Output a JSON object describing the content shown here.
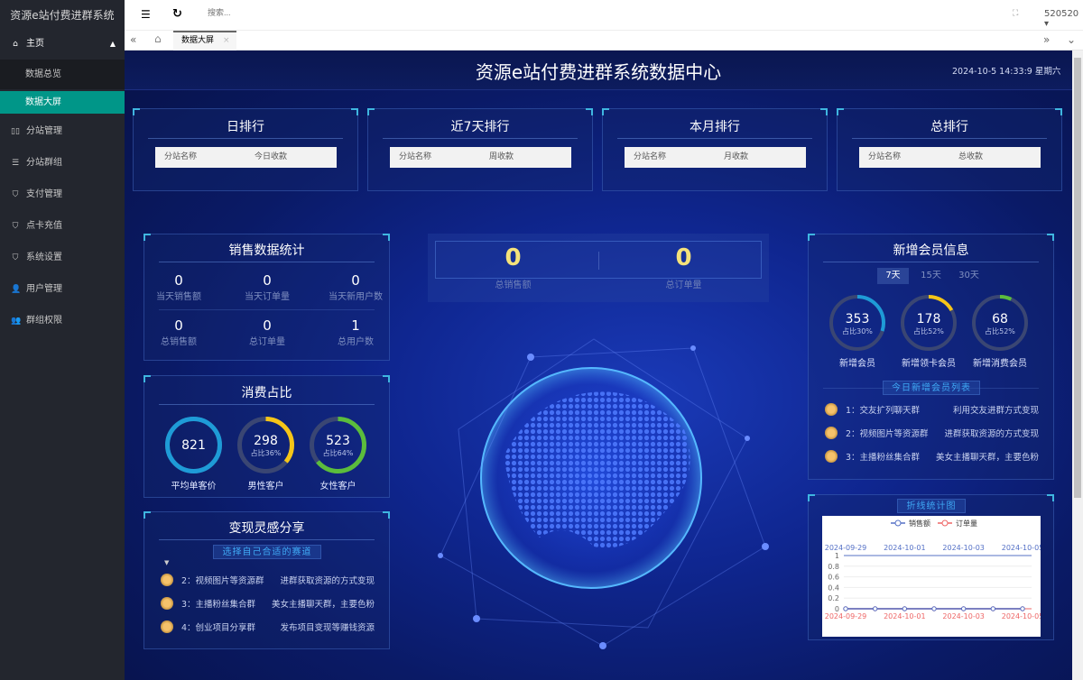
{
  "app": {
    "title": "资源e站付费进群系统",
    "user": "520520"
  },
  "sidebar": {
    "items": [
      {
        "label": "主页",
        "icon": "home-icon"
      },
      {
        "label": "数据总览"
      },
      {
        "label": "数据大屏"
      },
      {
        "label": "分站管理",
        "icon": "columns-icon"
      },
      {
        "label": "分站群组",
        "icon": "sliders-icon"
      },
      {
        "label": "支付管理",
        "icon": "shield-check-icon"
      },
      {
        "label": "点卡充值",
        "icon": "shield-check-icon"
      },
      {
        "label": "系统设置",
        "icon": "shield-check-icon"
      },
      {
        "label": "用户管理",
        "icon": "user-icon"
      },
      {
        "label": "群组权限",
        "icon": "users-icon"
      }
    ]
  },
  "topbar": {
    "search_placeholder": "搜索..."
  },
  "tabs": [
    {
      "label": "数据大屏",
      "active": true
    }
  ],
  "screen": {
    "title": "资源e站付费进群系统数据中心",
    "datetime": "2024-10-5 14:33:9 星期六"
  },
  "rankings": [
    {
      "title": "日排行",
      "col1": "分站名称",
      "col2": "今日收款"
    },
    {
      "title": "近7天排行",
      "col1": "分站名称",
      "col2": "周收款"
    },
    {
      "title": "本月排行",
      "col1": "分站名称",
      "col2": "月收款"
    },
    {
      "title": "总排行",
      "col1": "分站名称",
      "col2": "总收款"
    }
  ],
  "sales": {
    "title": "销售数据统计",
    "stats": [
      {
        "value": "0",
        "label": "当天销售额"
      },
      {
        "value": "0",
        "label": "当天订单量"
      },
      {
        "value": "0",
        "label": "当天新用户数"
      },
      {
        "value": "0",
        "label": "总销售额"
      },
      {
        "value": "0",
        "label": "总订单量"
      },
      {
        "value": "1",
        "label": "总用户数"
      }
    ]
  },
  "consumption": {
    "title": "消费占比",
    "rings": [
      {
        "value": "821",
        "pct_label": "",
        "label": "平均单客价",
        "fraction": 1.0,
        "color": "#1e9bd7"
      },
      {
        "value": "298",
        "pct_label": "占比36%",
        "label": "男性客户",
        "fraction": 0.36,
        "color": "#f5c518"
      },
      {
        "value": "523",
        "pct_label": "占比64%",
        "label": "女性客户",
        "fraction": 0.64,
        "color": "#5bbd3c"
      }
    ]
  },
  "ideas": {
    "title": "变现灵感分享",
    "subtitle": "选择自己合适的赛道",
    "items": [
      {
        "name": "2：视频图片等资源群",
        "desc": "进群获取资源的方式变现"
      },
      {
        "name": "3：主播粉丝集合群",
        "desc": "美女主播聊天群，主要色粉"
      },
      {
        "name": "4：创业项目分享群",
        "desc": "发布项目变现等赚钱资源"
      }
    ]
  },
  "totals": [
    {
      "value": "0",
      "label": "总销售额"
    },
    {
      "value": "0",
      "label": "总订单量"
    }
  ],
  "members": {
    "title": "新增会员信息",
    "periods": [
      "7天",
      "15天",
      "30天"
    ],
    "active_period": "7天",
    "rings": [
      {
        "value": "353",
        "pct_label": "占比30%",
        "label": "新增会员",
        "fraction": 0.3,
        "color": "#1e9bd7"
      },
      {
        "value": "178",
        "pct_label": "占比52%",
        "label": "新增领卡会员",
        "fraction": 0.17,
        "color": "#f5c518"
      },
      {
        "value": "68",
        "pct_label": "占比52%",
        "label": "新增消费会员",
        "fraction": 0.07,
        "color": "#5bbd3c"
      }
    ],
    "list_title": "今日新增会员列表",
    "list": [
      {
        "name": "1：交友扩列聊天群",
        "desc": "利用交友进群方式变现"
      },
      {
        "name": "2：视频图片等资源群",
        "desc": "进群获取资源的方式变现"
      },
      {
        "name": "3：主播粉丝集合群",
        "desc": "美女主播聊天群，主要色粉"
      }
    ]
  },
  "chart_panel_title": "折线统计图",
  "chart_data": {
    "type": "line",
    "x": [
      "2024-09-29",
      "2024-09-30",
      "2024-10-01",
      "2024-10-02",
      "2024-10-03",
      "2024-10-04",
      "2024-10-05"
    ],
    "x_tick_labels": [
      "2024-09-29",
      "2024-10-01",
      "2024-10-03",
      "2024-10-05"
    ],
    "series": [
      {
        "name": "销售额",
        "values": [
          0,
          0,
          0,
          0,
          0,
          0,
          0
        ],
        "color": "#5470c6",
        "axis": "top"
      },
      {
        "name": "订单量",
        "values": [
          0,
          0,
          0,
          0,
          0,
          0,
          0
        ],
        "color": "#ee6666",
        "axis": "bottom"
      }
    ],
    "ylim": [
      0,
      1
    ],
    "y_ticks": [
      "0",
      "0.2",
      "0.4",
      "0.6",
      "0.8",
      "1"
    ],
    "legend": "top",
    "grid": true
  }
}
